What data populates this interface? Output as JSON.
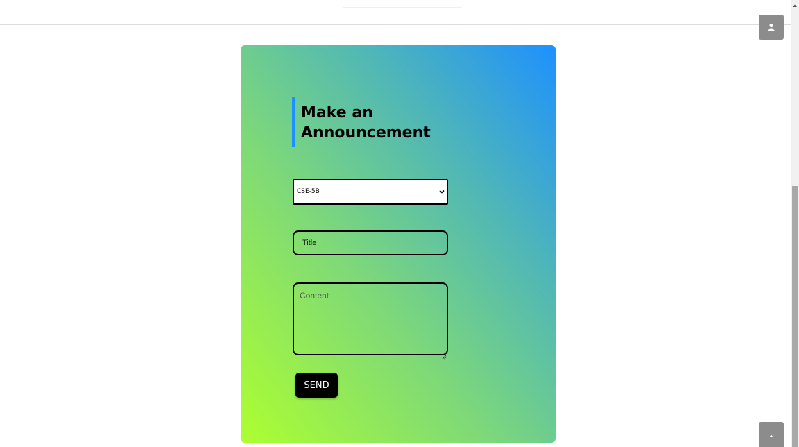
{
  "form": {
    "heading": "Make an Announcement",
    "class_select": {
      "selected": "CSE-5B",
      "options": [
        "CSE-5B"
      ]
    },
    "title_placeholder": "Title",
    "content_placeholder": "Content",
    "send_label": "SEND"
  },
  "icons": {
    "user": "user-icon",
    "scroll_top": "chevron-up-icon",
    "select_arrow": "chevron-down-icon",
    "scrollbar_up": "scroll-up-arrow-icon"
  },
  "colors": {
    "gradient_bottom_left": "#adff2f",
    "gradient_top_right": "#1e90ff",
    "heading_accent": "#1e90ff",
    "button_bg": "#000000",
    "floating_button_bg": "#8c8c8c"
  }
}
